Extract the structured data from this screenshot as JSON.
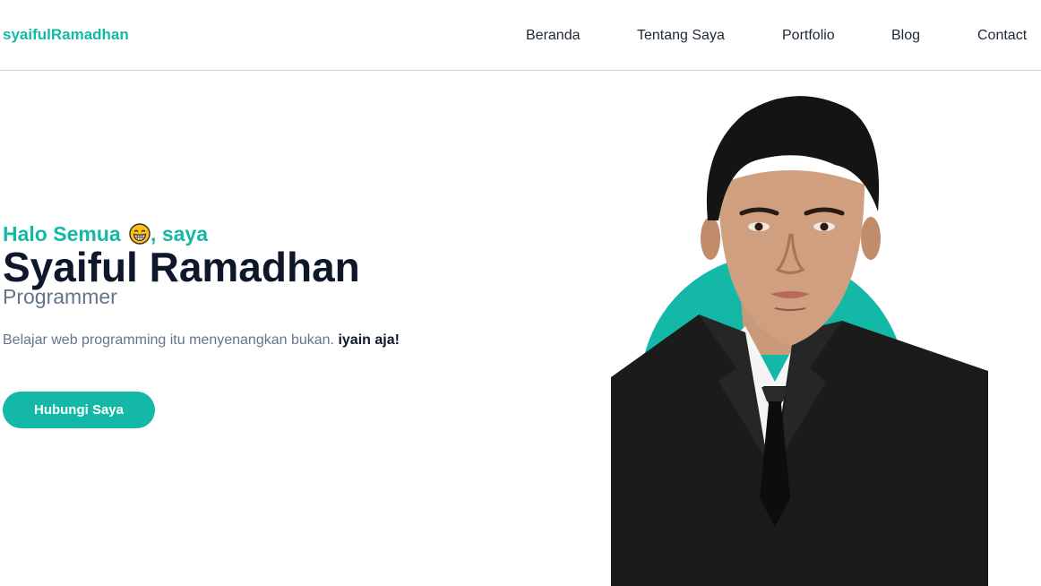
{
  "brand": {
    "name": "syaifulRamadhan"
  },
  "nav": {
    "items": [
      {
        "label": "Beranda"
      },
      {
        "label": "Tentang Saya"
      },
      {
        "label": "Portfolio"
      },
      {
        "label": "Blog"
      },
      {
        "label": "Contact"
      }
    ]
  },
  "hero": {
    "greeting_before": "Halo Semua",
    "greeting_emoji": "grinning-face-icon",
    "greeting_after": ", saya",
    "name": "Syaiful Ramadhan",
    "role": "Programmer",
    "tagline": "Belajar web programming itu menyenangkan bukan.",
    "tagline_bold": "iyain aja!",
    "cta_label": "Hubungi Saya"
  },
  "colors": {
    "accent": "#14b8a6",
    "heading": "#0f172a",
    "muted": "#64748b"
  }
}
